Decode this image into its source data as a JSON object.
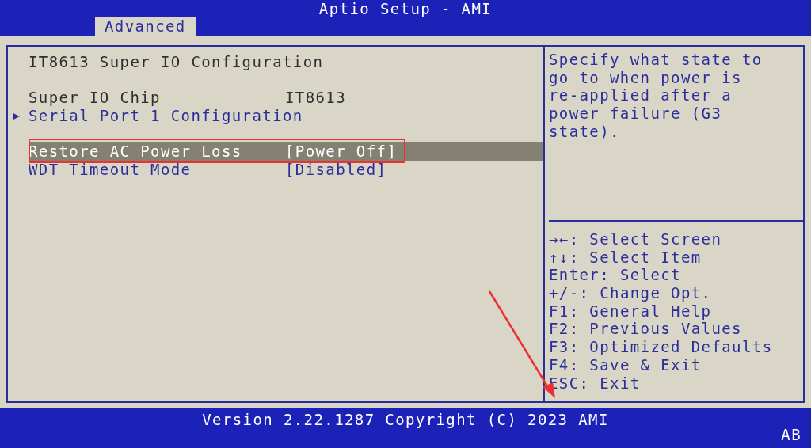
{
  "window": {
    "title": "Aptio Setup - AMI"
  },
  "tabs": [
    {
      "label": "Advanced",
      "selected": true
    }
  ],
  "items": [
    {
      "kind": "header",
      "label": "IT8613 Super IO Configuration"
    },
    {
      "kind": "spacer"
    },
    {
      "kind": "info",
      "label": "Super IO Chip",
      "value": "IT8613"
    },
    {
      "kind": "submenu",
      "label": "Serial Port 1 Configuration",
      "marker": "▶"
    },
    {
      "kind": "spacer"
    },
    {
      "kind": "setting",
      "label": "Restore AC Power Loss",
      "value": "[Power Off]",
      "selected": true,
      "annotated": true
    },
    {
      "kind": "setting",
      "label": "WDT Timeout Mode",
      "value": "[Disabled]",
      "selected": false,
      "annotated": false
    }
  ],
  "help": [
    "Specify what state to",
    "go to when power is",
    "re-applied after a",
    "power failure (G3",
    "state)."
  ],
  "keys": [
    {
      "key": "→←",
      "action": ": Select Screen"
    },
    {
      "key": "↑↓",
      "action": ": Select Item"
    },
    {
      "key": "Enter",
      "action": ": Select"
    },
    {
      "key": "+/-",
      "action": ": Change Opt."
    },
    {
      "key": "F1",
      "action": ": General Help"
    },
    {
      "key": "F2",
      "action": ": Previous Values"
    },
    {
      "key": "F3",
      "action": ": Optimized Defaults"
    },
    {
      "key": "F4",
      "action": ": Save & Exit"
    },
    {
      "key": "ESC",
      "action": ": Exit"
    }
  ],
  "status_bar": {
    "version": "Version 2.22.1287 Copyright (C) 2023 AMI",
    "indicator": "AB"
  }
}
